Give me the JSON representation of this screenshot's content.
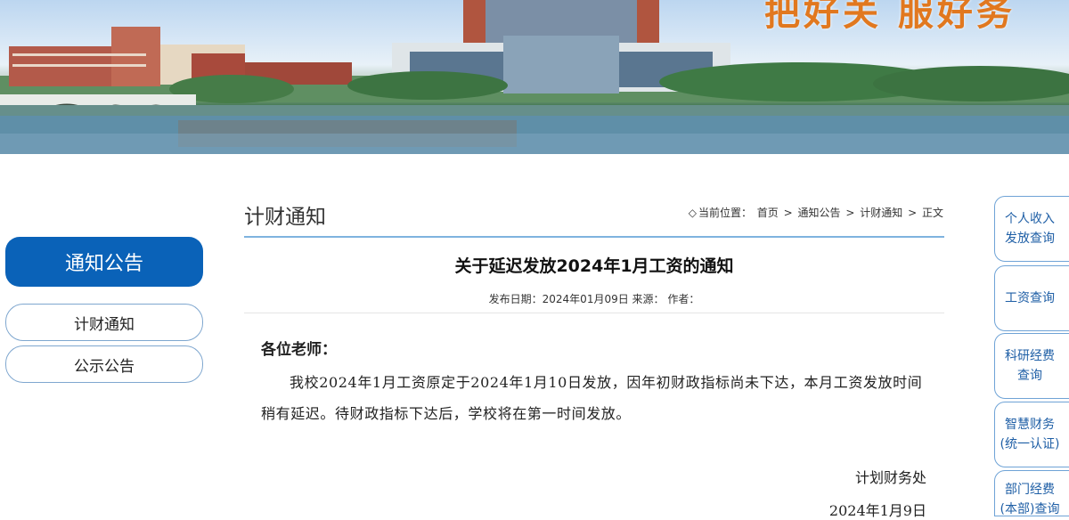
{
  "banner": {
    "slogan": "把好关  服好务"
  },
  "sidebar": {
    "title": "通知公告",
    "items": [
      {
        "label": "计财通知"
      },
      {
        "label": "公示公告"
      }
    ]
  },
  "main": {
    "heading": "计财通知",
    "breadcrumb": {
      "marker": "◇",
      "prefix": "当前位置：",
      "items": [
        "首页",
        "通知公告",
        "计财通知",
        "正文"
      ],
      "separator": ">"
    },
    "article": {
      "title": "关于延迟发放2024年1月工资的通知",
      "meta": "发布日期：2024年01月09日 来源：   作者：",
      "salutation": "各位老师：",
      "body": "我校2024年1月工资原定于2024年1月10日发放，因年初财政指标尚未下达，本月工资发放时间稍有延迟。待财政指标下达后，学校将在第一时间发放。",
      "signature_dept": "计划财务处",
      "signature_date": "2024年1月9日"
    }
  },
  "quick_links": [
    {
      "line1": "个人收入",
      "line2": "发放查询"
    },
    {
      "line1": "工资查询",
      "line2": ""
    },
    {
      "line1": "科研经费",
      "line2": "查询"
    },
    {
      "line1": "智慧财务",
      "line2": "(统一认证)"
    },
    {
      "line1": "部门经费",
      "line2": "(本部)查询"
    }
  ],
  "colors": {
    "primary_blue": "#0a62b8",
    "border_blue": "#7fa7cf",
    "slogan_orange": "#e1781f"
  }
}
